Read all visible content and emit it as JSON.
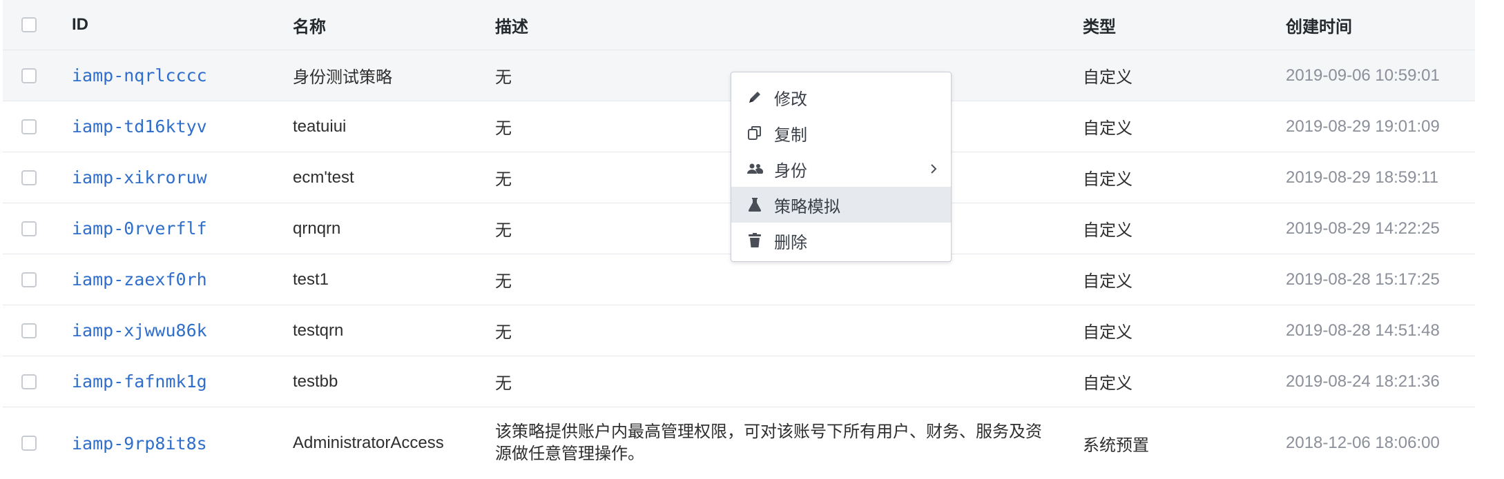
{
  "table": {
    "headers": {
      "id": "ID",
      "name": "名称",
      "desc": "描述",
      "type": "类型",
      "time": "创建时间"
    },
    "rows": [
      {
        "id": "iamp-nqrlcccc",
        "name": "身份测试策略",
        "desc": "无",
        "type": "自定义",
        "time": "2019-09-06 10:59:01"
      },
      {
        "id": "iamp-td16ktyv",
        "name": "teatuiui",
        "desc": "无",
        "type": "自定义",
        "time": "2019-08-29 19:01:09"
      },
      {
        "id": "iamp-xikroruw",
        "name": "ecm'test",
        "desc": "无",
        "type": "自定义",
        "time": "2019-08-29 18:59:11"
      },
      {
        "id": "iamp-0rverflf",
        "name": "qrnqrn",
        "desc": "无",
        "type": "自定义",
        "time": "2019-08-29 14:22:25"
      },
      {
        "id": "iamp-zaexf0rh",
        "name": "test1",
        "desc": "无",
        "type": "自定义",
        "time": "2019-08-28 15:17:25"
      },
      {
        "id": "iamp-xjwwu86k",
        "name": "testqrn",
        "desc": "无",
        "type": "自定义",
        "time": "2019-08-28 14:51:48"
      },
      {
        "id": "iamp-fafnmk1g",
        "name": "testbb",
        "desc": "无",
        "type": "自定义",
        "time": "2019-08-24 18:21:36"
      },
      {
        "id": "iamp-9rp8it8s",
        "name": "AdministratorAccess",
        "desc": "该策略提供账户内最高管理权限，可对该账号下所有用户、财务、服务及资源做任意管理操作。",
        "type": "系统预置",
        "time": "2018-12-06 18:06:00"
      }
    ]
  },
  "context_menu": {
    "items": [
      {
        "label": "修改",
        "icon": "pencil-icon"
      },
      {
        "label": "复制",
        "icon": "copy-icon"
      },
      {
        "label": "身份",
        "icon": "users-icon",
        "submenu": true
      },
      {
        "label": "策略模拟",
        "icon": "flask-icon",
        "active": true
      },
      {
        "label": "删除",
        "icon": "trash-icon"
      }
    ]
  },
  "colors": {
    "link": "#2f6ecb",
    "header_bg": "#f5f6f7",
    "border": "#e4e7eb",
    "menu_active_bg": "#e6e9ee"
  }
}
